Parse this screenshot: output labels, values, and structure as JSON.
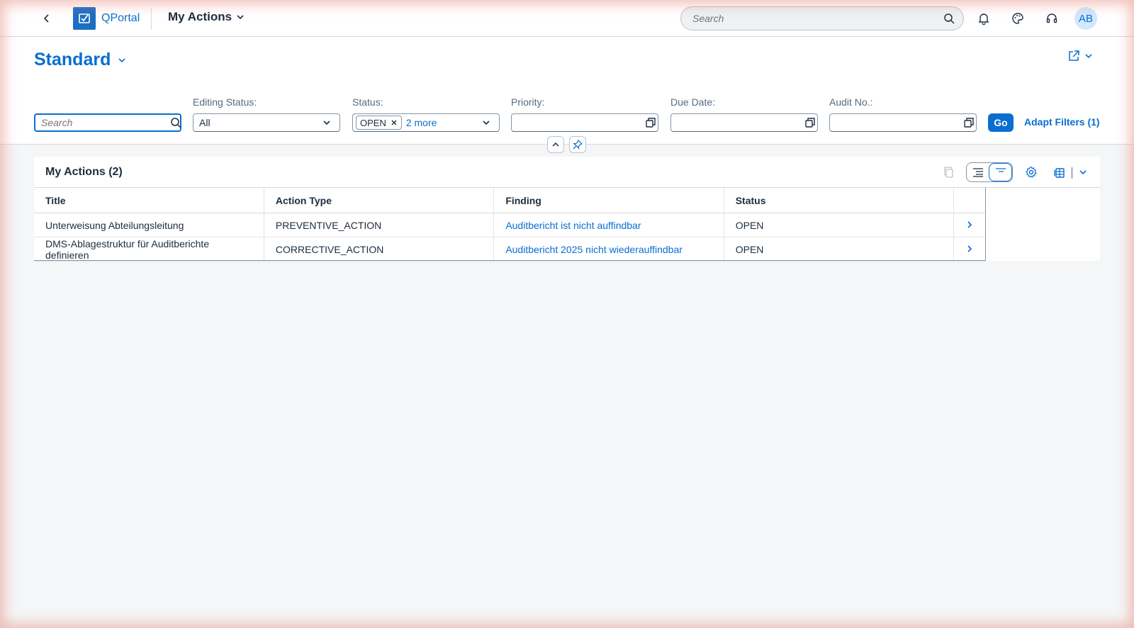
{
  "shell": {
    "app_name": "QPortal",
    "page_title": "My Actions",
    "search_placeholder": "Search",
    "avatar_initials": "AB"
  },
  "header": {
    "variant_name": "Standard"
  },
  "filters": {
    "search_placeholder": "Search",
    "editing_status": {
      "label": "Editing Status:",
      "value": "All"
    },
    "status": {
      "label": "Status:",
      "token": "OPEN",
      "more": "2 more"
    },
    "priority": {
      "label": "Priority:",
      "value": ""
    },
    "due_date": {
      "label": "Due Date:",
      "value": ""
    },
    "audit_no": {
      "label": "Audit No.:",
      "value": ""
    },
    "go_label": "Go",
    "adapt_label": "Adapt Filters (1)"
  },
  "table": {
    "title": "My Actions (2)",
    "columns": [
      "Title",
      "Action Type",
      "Finding",
      "Status"
    ],
    "rows": [
      {
        "title": "Unterweisung Abteilungsleitung",
        "action_type": "PREVENTIVE_ACTION",
        "finding": "Auditbericht ist nicht auffindbar",
        "status": "OPEN"
      },
      {
        "title": "DMS-Ablagestruktur für Auditberichte definieren",
        "action_type": "CORRECTIVE_ACTION",
        "finding": "Auditbericht 2025 nicht wiederauffindbar",
        "status": "OPEN"
      }
    ]
  },
  "colors": {
    "brand": "#0a6ed1",
    "text": "#1d2d3e",
    "background": "#f5f6f7"
  }
}
